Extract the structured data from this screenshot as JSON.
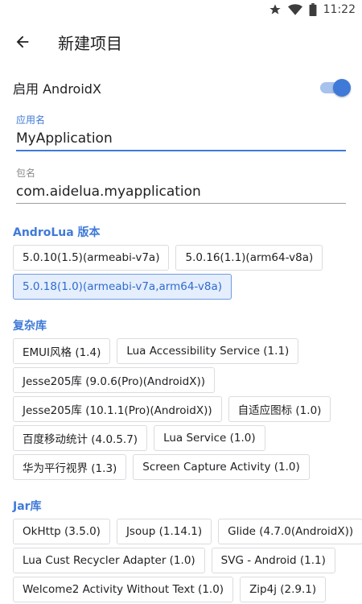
{
  "status_bar": {
    "time": "11:22",
    "icons": [
      "star-icon",
      "wifi-icon",
      "battery-icon"
    ]
  },
  "toolbar": {
    "title": "新建项目",
    "back_icon": "arrow-left-icon"
  },
  "androidx": {
    "label": "启用 AndroidX",
    "enabled": true
  },
  "app_name": {
    "label": "应用名",
    "value": "MyApplication"
  },
  "package": {
    "label": "包名",
    "value": "com.aidelua.myapplication"
  },
  "androlua": {
    "title": "AndroLua 版本",
    "options": [
      "5.0.10(1.5)(armeabi-v7a)",
      "5.0.16(1.1)(arm64-v8a)",
      "5.0.18(1.0)(armeabi-v7a,arm64-v8a)"
    ],
    "selected": "5.0.18(1.0)(armeabi-v7a,arm64-v8a)"
  },
  "complex_libs": {
    "title": "复杂库",
    "items": [
      "EMUI风格 (1.4)",
      "Lua Accessibility Service (1.1)",
      "Jesse205库 (9.0.6(Pro)(AndroidX))",
      "Jesse205库 (10.1.1(Pro)(AndroidX))",
      "自适应图标 (1.0)",
      "百度移动统计 (4.0.5.7)",
      "Lua Service (1.0)",
      "华为平行视界 (1.3)",
      "Screen Capture Activity (1.0)"
    ]
  },
  "jar_libs": {
    "title": "Jar库",
    "items": [
      "OkHttp (3.5.0)",
      "Jsoup (1.14.1)",
      "Glide (4.7.0(AndroidX))",
      "Lua Cust Recycler Adapter (1.0)",
      "SVG - Android (1.1)",
      "Welcome2 Activity Without Text (1.0)",
      "Zip4j (2.9.1)"
    ]
  },
  "colors": {
    "accent": "#3f7ad8",
    "chip_border": "#dadce0",
    "selected_bg": "#e5eefc"
  }
}
